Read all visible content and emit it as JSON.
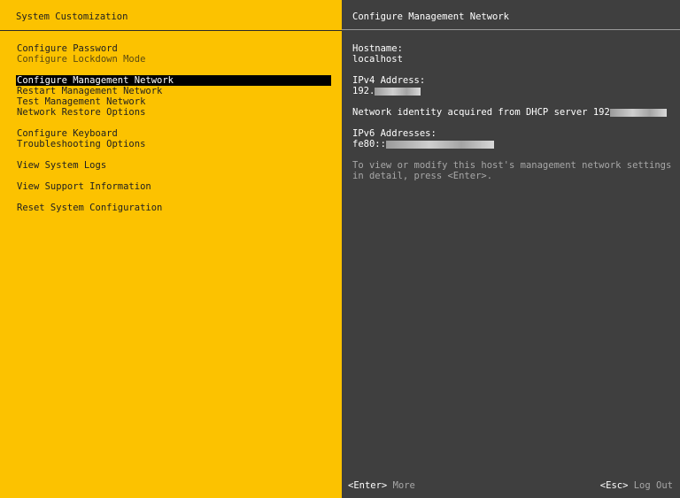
{
  "left_panel": {
    "title": "System Customization",
    "menu": [
      {
        "label": "Configure Password",
        "dim": false,
        "selected": false
      },
      {
        "label": "Configure Lockdown Mode",
        "dim": true,
        "selected": false
      },
      {
        "label": "Configure Management Network",
        "dim": false,
        "selected": true
      },
      {
        "label": "Restart Management Network",
        "dim": false,
        "selected": false
      },
      {
        "label": "Test Management Network",
        "dim": false,
        "selected": false
      },
      {
        "label": "Network Restore Options",
        "dim": false,
        "selected": false
      },
      {
        "label": "Configure Keyboard",
        "dim": false,
        "selected": false
      },
      {
        "label": "Troubleshooting Options",
        "dim": false,
        "selected": false
      },
      {
        "label": "View System Logs",
        "dim": false,
        "selected": false
      },
      {
        "label": "View Support Information",
        "dim": false,
        "selected": false
      },
      {
        "label": "Reset System Configuration",
        "dim": false,
        "selected": false
      }
    ]
  },
  "right_panel": {
    "title": "Configure Management Network",
    "hostname_label": "Hostname:",
    "hostname_value": "localhost",
    "ipv4_label": "IPv4 Address:",
    "ipv4_value": "192.",
    "dhcp_text": "Network identity acquired from DHCP server 192",
    "ipv6_label": "IPv6 Addresses:",
    "ipv6_value": "fe80::",
    "hint": "To view or modify this host's management network settings in detail, press <Enter>."
  },
  "footer": {
    "enter_key": "<Enter>",
    "enter_action": "More",
    "esc_key": "<Esc>",
    "esc_action": "Log Out"
  }
}
